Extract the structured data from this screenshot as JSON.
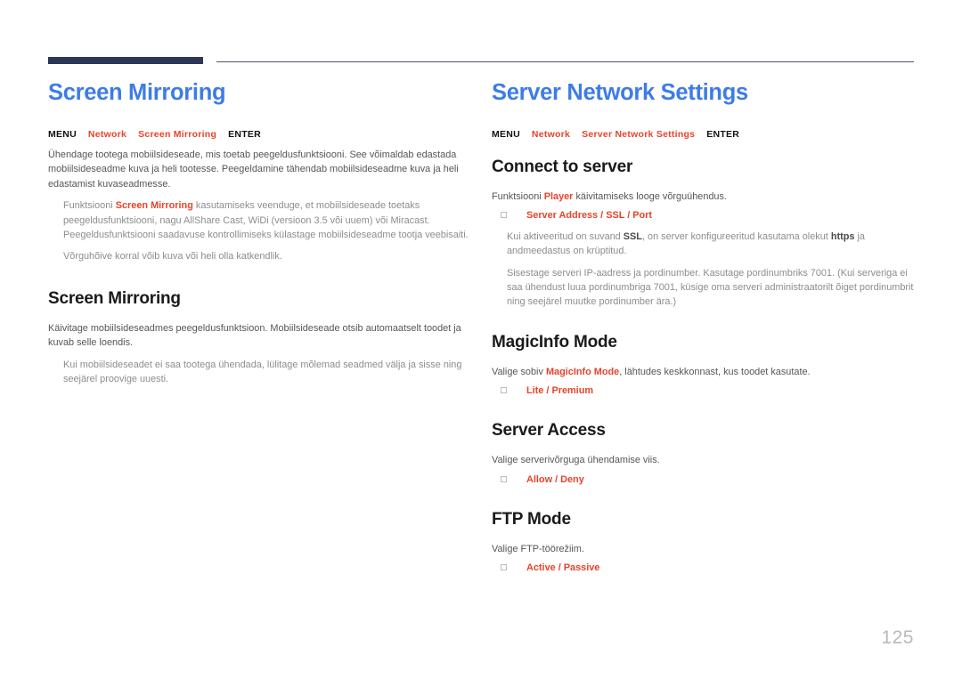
{
  "page": {
    "number": "125"
  },
  "left": {
    "title": "Screen Mirroring",
    "menupath": {
      "menu": "MENU",
      "item1": "Network",
      "item2": "Screen Mirroring",
      "enter": "ENTER"
    },
    "intro": "Ühendage tootega mobiilsideseade, mis toetab peegeldusfunktsiooni. See võimaldab edastada mobiilsideseadme kuva ja heli tootesse. Peegeldamine tähendab mobiilsideseadme kuva ja heli edastamist kuvaseadmesse.",
    "note1_pre": "Funktsiooni ",
    "note1_em": "Screen Mirroring",
    "note1_post": " kasutamiseks veenduge, et mobiilsideseade toetaks peegeldusfunktsiooni, nagu AllShare Cast, WiDi (versioon 3.5 või uuem) või Miracast. Peegeldusfunktsiooni saadavuse kontrollimiseks külastage mobiilsideseadme tootja veebisaiti.",
    "note2": "Võrguhõive korral võib kuva või heli olla katkendlik.",
    "section": {
      "heading": "Screen Mirroring",
      "body": "Käivitage mobiilsideseadmes peegeldusfunktsioon. Mobiilsideseade otsib automaatselt toodet ja kuvab selle loendis.",
      "note": "Kui mobiilsideseadet ei saa tootega ühendada, lülitage mõlemad seadmed välja ja sisse ning seejärel proovige uuesti."
    }
  },
  "right": {
    "title": "Server Network Settings",
    "menupath": {
      "menu": "MENU",
      "item1": "Network",
      "item2": "Server Network Settings",
      "enter": "ENTER"
    },
    "connect": {
      "heading": "Connect to server",
      "body_pre": "Funktsiooni ",
      "body_em": "Player",
      "body_post": " käivitamiseks looge võrguühendus.",
      "option": "Server Address / SSL / Port",
      "note1_pre": "Kui aktiveeritud on suvand ",
      "note1_em": "SSL",
      "note1_mid": ", on server konfigureeritud kasutama olekut ",
      "note1_bk": "https",
      "note1_post": " ja andmeedastus on krüptitud.",
      "note2": "Sisestage serveri IP-aadress ja pordinumber. Kasutage pordinumbriks 7001. (Kui serveriga ei saa ühendust luua pordinumbriga 7001, küsige oma serveri administraatorilt õiget pordinumbrit ning seejärel muutke pordinumber ära.)"
    },
    "magicinfo": {
      "heading": "MagicInfo Mode",
      "body_pre": "Valige sobiv ",
      "body_em": "MagicInfo Mode",
      "body_post": ", lähtudes keskkonnast, kus toodet kasutate.",
      "option": "Lite / Premium"
    },
    "access": {
      "heading": "Server Access",
      "body": "Valige serverivõrguga ühendamise viis.",
      "option": "Allow / Deny"
    },
    "ftp": {
      "heading": "FTP Mode",
      "body": "Valige FTP-töörežiim.",
      "option": "Active / Passive"
    }
  }
}
